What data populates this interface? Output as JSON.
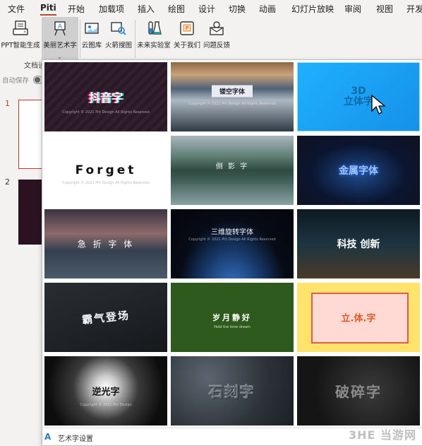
{
  "menu": {
    "tabs": [
      "文件",
      "Piti",
      "开始",
      "加载项",
      "插入",
      "绘图",
      "设计",
      "切换",
      "动画",
      "幻灯片放映",
      "审阅",
      "视图",
      "开发"
    ]
  },
  "ribbon": {
    "buttons": [
      "PPT智能生成",
      "美丽艺术字",
      "云图库",
      "火箭搜图",
      "未来实验室",
      "关于我们",
      "问题反馈"
    ]
  },
  "left": {
    "group_label": "文档设",
    "autosave_label": "自动保存",
    "slide_numbers": [
      "1",
      "2"
    ]
  },
  "gallery": {
    "tiles": [
      {
        "caption": "抖音字",
        "sub": "Copyright © 2021 Piti Design  All Rights Reserved"
      },
      {
        "caption": "镂空字体",
        "sub": "Copyright © 2021 Piti Design  All Rights Reserved"
      },
      {
        "caption": "3D\n立体字",
        "sub": ""
      },
      {
        "caption": "Forget",
        "sub": "Copyright © 2021 Piti Design  All Rights Reserved"
      },
      {
        "caption": "倒  影  字",
        "sub": ""
      },
      {
        "caption": "金属字体",
        "sub": ""
      },
      {
        "caption": "急 折 字 体",
        "sub": ""
      },
      {
        "caption": "三维旋转字体",
        "sub": "Copyright © 2021 Piti Design  All Rights Reserved"
      },
      {
        "caption": "科技 创新",
        "sub": ""
      },
      {
        "caption": "霸气登场",
        "sub": ""
      },
      {
        "caption": "岁月静好",
        "sub": "Hold  the  time  dream"
      },
      {
        "caption": "立.体.字",
        "sub": ""
      },
      {
        "caption": "逆光字",
        "sub": "Copyright © 2021 Piti Design"
      },
      {
        "caption": "石刻字",
        "sub": ""
      },
      {
        "caption": "破碎字",
        "sub": ""
      }
    ],
    "footer_label": "艺术字设置",
    "footer_icon": "A"
  },
  "watermark": "3HE 当游网",
  "colors": {
    "accent": "#b7472a",
    "selected_tile": "#1ea7f5"
  }
}
